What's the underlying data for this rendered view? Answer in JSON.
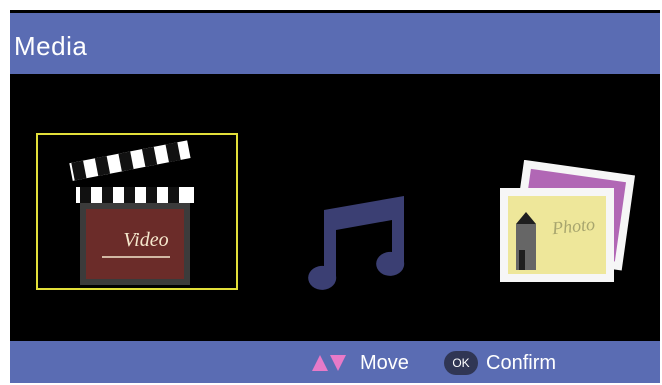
{
  "header": {
    "title": "Media"
  },
  "menu": {
    "selected_index": 0,
    "items": [
      {
        "id": "video",
        "label": "Video",
        "icon": "clapperboard-icon"
      },
      {
        "id": "music",
        "label": "",
        "icon": "music-note-icon"
      },
      {
        "id": "photo",
        "label": "Photo",
        "icon": "photo-icon"
      }
    ]
  },
  "footer": {
    "move_label": "Move",
    "confirm_label": "Confirm",
    "ok_badge": "OK"
  },
  "colors": {
    "bar_blue": "#5a6cb3",
    "selection_yellow": "#e2df3a",
    "arrow_pink": "#e87ac8",
    "music_note": "#3b3f73",
    "clapper_board": "#6b2c29"
  }
}
